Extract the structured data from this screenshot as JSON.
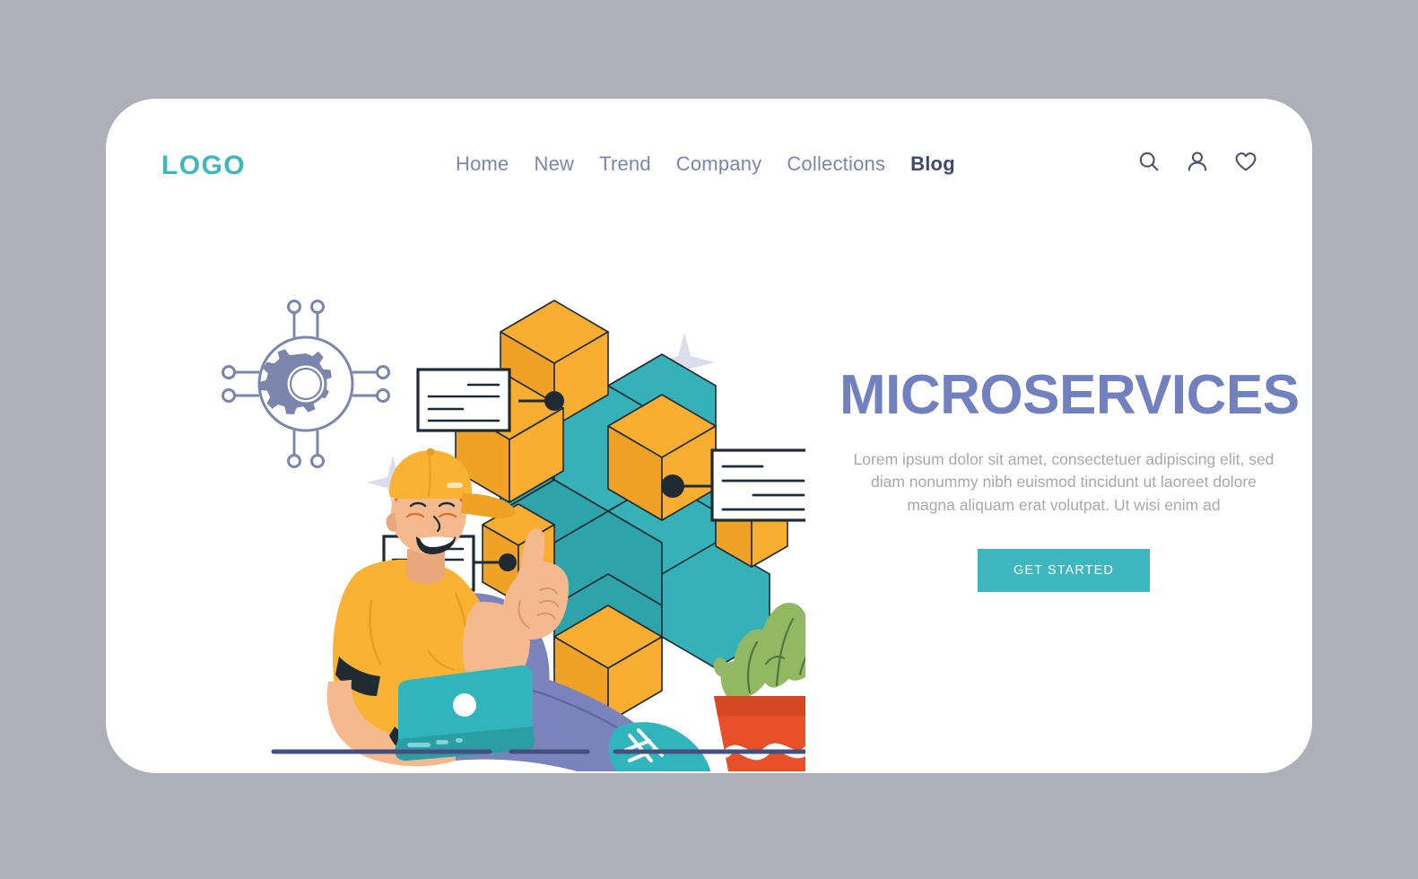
{
  "page": {
    "background_color": "#afafb9",
    "card_color": "#ffffff"
  },
  "header": {
    "logo_text": "LOGO",
    "logo_color": "#3bb9bd",
    "nav_items": [
      {
        "label": "Home",
        "active": false
      },
      {
        "label": "New",
        "active": false
      },
      {
        "label": "Trend",
        "active": false
      },
      {
        "label": "Company",
        "active": false
      },
      {
        "label": "Collections",
        "active": false
      },
      {
        "label": "Blog",
        "active": true
      }
    ],
    "actions": [
      {
        "icon": "search-icon"
      },
      {
        "icon": "user-icon"
      },
      {
        "icon": "heart-icon"
      }
    ]
  },
  "hero": {
    "title": "MICROSERVICES",
    "title_color": "#7180bf",
    "paragraph": "Lorem ipsum dolor sit amet, consectetuer adipiscing elit, sed diam nonummy nibh euismod tincidunt ut laoreet dolore magna aliquam erat volutpat. Ut wisi enim ad",
    "paragraph_color": "#a9a9ad",
    "cta_label": "GET STARTED",
    "cta_color": "#3eb6bd"
  },
  "illustration": {
    "name": "developer-with-microservices-cube",
    "colors": {
      "cube_teal": "#35b1b7",
      "cube_orange": "#f9ad31",
      "outline": "#1f2a33",
      "shirt": "#f9b233",
      "pants": "#7b83bd",
      "skin": "#f5b98e",
      "laptop": "#2fb5bb",
      "shoe": "#2fb5bb",
      "pot": "#e8502a",
      "plant": "#93b863",
      "gear": "#7c85ab",
      "sparkle": "#dcdcea",
      "ground_line": "#454f7e"
    },
    "elements": [
      "gear-network-icon",
      "isometric-cube-stack",
      "callout-card-left",
      "callout-card-right",
      "callout-card-bottom",
      "seated-developer",
      "laptop",
      "potted-plant",
      "sparkles",
      "ground-lines"
    ]
  }
}
